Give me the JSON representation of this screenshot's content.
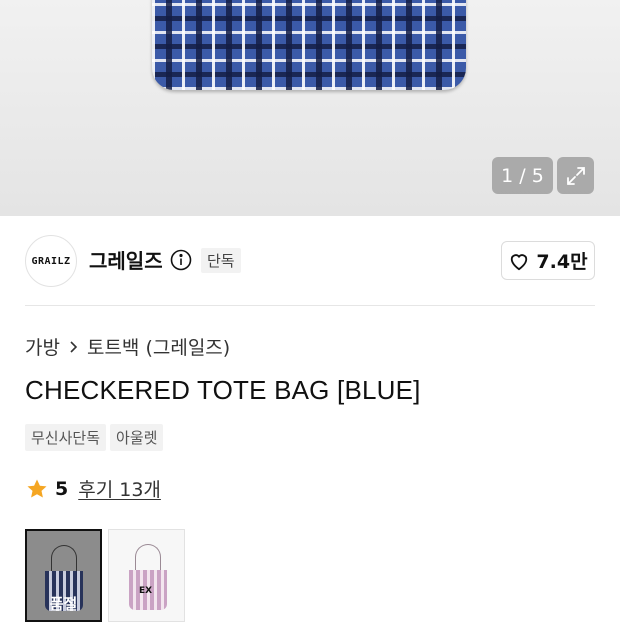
{
  "gallery": {
    "counter": "1 / 5",
    "expand_icon": "expand-icon"
  },
  "brand": {
    "logo_text": "GRAILZ",
    "name": "그레일즈",
    "info_icon": "info-icon",
    "exclusive_label": "단독"
  },
  "like": {
    "icon": "heart-icon",
    "count": "7.4만"
  },
  "breadcrumb": {
    "category": "가방",
    "subcategory": "토트백 (그레일즈)",
    "separator_icon": "chevron-right-icon"
  },
  "product": {
    "title": "CHECKERED TOTE BAG [BLUE]",
    "tags": [
      "무신사단독",
      "아울렛"
    ]
  },
  "rating": {
    "star_icon": "star-icon",
    "score": "5",
    "review_label": "후기 13개",
    "star_color": "#F5A623"
  },
  "thumbnails": [
    {
      "variant": "blue",
      "overlay": "품절",
      "selected": true
    },
    {
      "variant": "pink",
      "label": "EX",
      "selected": false
    }
  ]
}
